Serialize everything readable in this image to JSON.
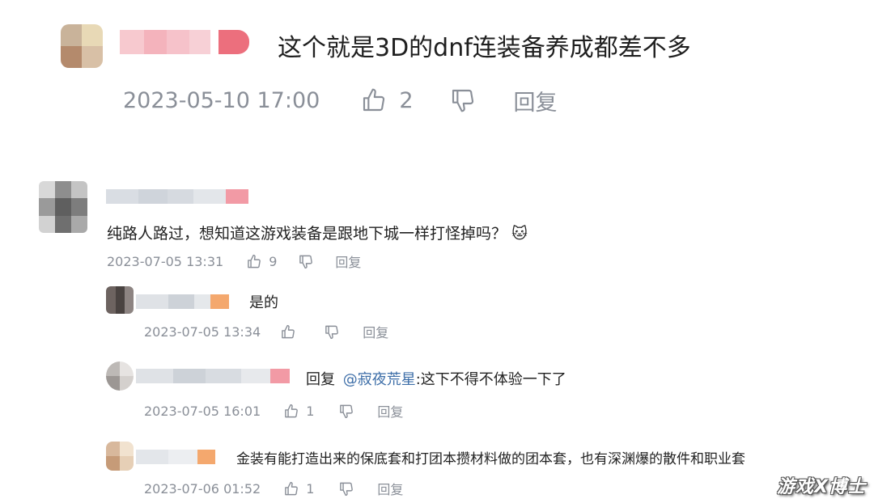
{
  "main_comment": {
    "text": "这个就是3D的dnf连装备养成都差不多",
    "time": "2023-05-10 17:00",
    "likes": "2",
    "reply_label": "回复"
  },
  "thread": {
    "root": {
      "text": "纯路人路过，想知道这游戏装备是跟地下城一样打怪掉吗？",
      "emoji": "🐱",
      "time": "2023-07-05 13:31",
      "likes": "9",
      "reply_label": "回复"
    },
    "replies": [
      {
        "text": "是的",
        "time": "2023-07-05 13:34",
        "likes": "",
        "reply_label": "回复"
      },
      {
        "prefix": "回复",
        "mention": "@寂夜荒星",
        "text": ":这下不得不体验一下了",
        "time": "2023-07-05 16:01",
        "likes": "1",
        "reply_label": "回复"
      },
      {
        "text": "金装有能打造出来的保底套和打团本攒材料做的团本套，也有深渊爆的散件和职业套",
        "time": "2023-07-06 01:52",
        "likes": "1",
        "reply_label": "回复"
      }
    ]
  },
  "watermark": "游戏X博士",
  "colors": {
    "meta_gray": "#8a8f98",
    "mention_blue": "#3d6ea8",
    "pink_pixel": "#f29aa5"
  }
}
